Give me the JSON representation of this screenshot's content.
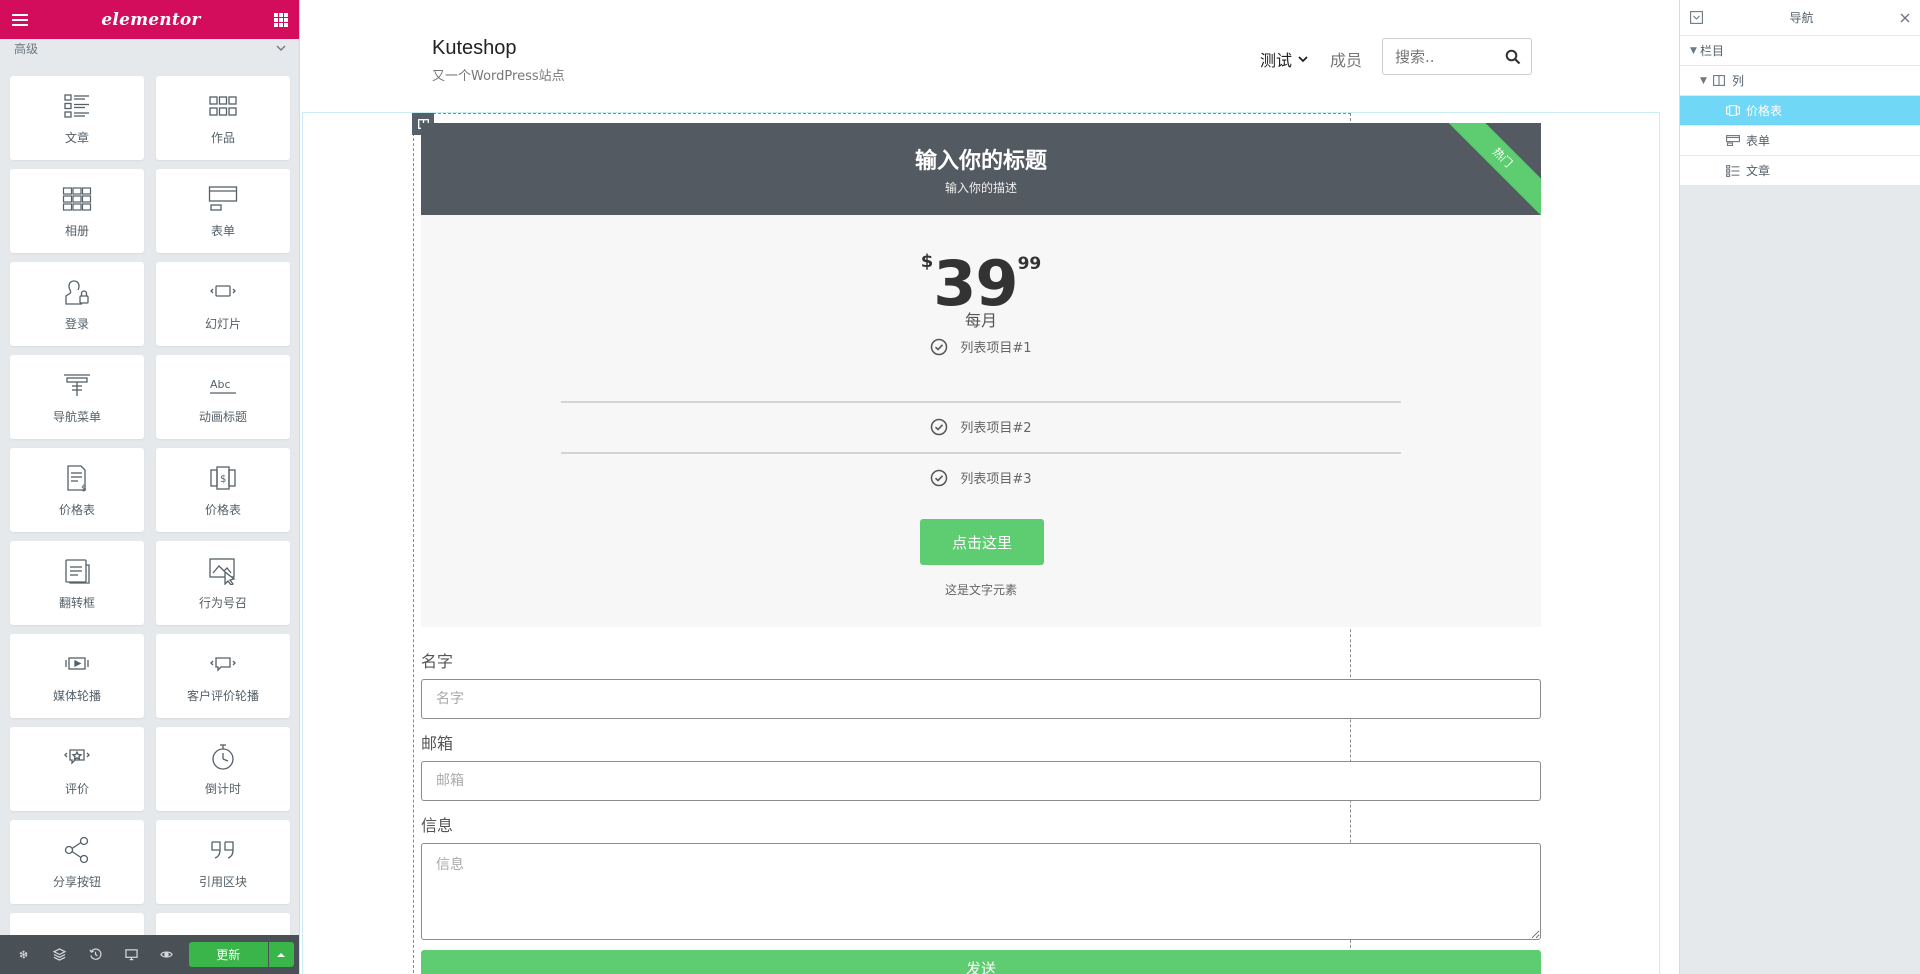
{
  "elementor_panel": {
    "logo": "elementor",
    "section_label": "高级",
    "widgets": [
      {
        "label": "文章",
        "icon": "posts-icon"
      },
      {
        "label": "作品",
        "icon": "portfolio-icon"
      },
      {
        "label": "相册",
        "icon": "gallery-icon"
      },
      {
        "label": "表单",
        "icon": "form-icon"
      },
      {
        "label": "登录",
        "icon": "login-icon"
      },
      {
        "label": "幻灯片",
        "icon": "slides-icon"
      },
      {
        "label": "导航菜单",
        "icon": "nav-menu-icon"
      },
      {
        "label": "动画标题",
        "icon": "animated-headline-icon"
      },
      {
        "label": "价格表",
        "icon": "price-list-icon"
      },
      {
        "label": "价格表",
        "icon": "price-table-icon"
      },
      {
        "label": "翻转框",
        "icon": "flip-box-icon"
      },
      {
        "label": "行为号召",
        "icon": "call-to-action-icon"
      },
      {
        "label": "媒体轮播",
        "icon": "media-carousel-icon"
      },
      {
        "label": "客户评价轮播",
        "icon": "testimonial-carousel-icon"
      },
      {
        "label": "评价",
        "icon": "reviews-icon"
      },
      {
        "label": "倒计时",
        "icon": "countdown-icon"
      },
      {
        "label": "分享按钮",
        "icon": "share-icon"
      },
      {
        "label": "引用区块",
        "icon": "blockquote-icon"
      }
    ],
    "footer": {
      "update_label": "更新"
    }
  },
  "site": {
    "title": "Kuteshop",
    "tagline": "又一个WordPress站点",
    "nav": [
      {
        "label": "测试"
      },
      {
        "label": "成员"
      }
    ],
    "search_placeholder": "搜索.."
  },
  "price_table": {
    "heading": "输入你的标题",
    "description": "输入你的描述",
    "ribbon": "热门",
    "currency": "$",
    "price_int": "39",
    "price_frac": "99",
    "period": "每月",
    "features": [
      "列表项目#1",
      "列表项目#2",
      "列表项目#3"
    ],
    "button": "点击这里",
    "additional_info": "这是文字元素"
  },
  "form": {
    "name_label": "名字",
    "name_placeholder": "名字",
    "email_label": "邮箱",
    "email_placeholder": "邮箱",
    "message_label": "信息",
    "message_placeholder": "信息",
    "submit": "发送"
  },
  "navigator": {
    "title": "导航",
    "tree": [
      {
        "label": "栏目",
        "level": 0
      },
      {
        "label": "列",
        "level": 1
      },
      {
        "label": "价格表",
        "level": 2,
        "active": true
      },
      {
        "label": "表单",
        "level": 2
      },
      {
        "label": "文章",
        "level": 2
      }
    ]
  },
  "colors": {
    "elementor_brand": "#d30c5c",
    "accent_green": "#5ecc71",
    "navigator_active": "#71d7f7",
    "price_header": "#545a61"
  }
}
